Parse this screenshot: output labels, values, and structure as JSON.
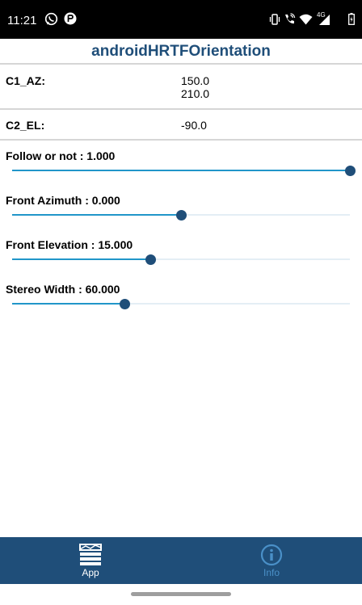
{
  "status_bar": {
    "time": "11:21",
    "network": "4G",
    "icons": [
      "whatsapp-icon",
      "app-notification-icon",
      "vibrate-icon",
      "wifi-calling-icon",
      "wifi-icon",
      "signal-icon",
      "battery-icon"
    ]
  },
  "app": {
    "title": "androidHRTFOrientation"
  },
  "rows": [
    {
      "label": "C1_AZ:",
      "values": [
        "150.0",
        "210.0"
      ]
    },
    {
      "label": "C2_EL:",
      "values": [
        "-90.0"
      ]
    }
  ],
  "sliders": [
    {
      "label": "Follow or not : 1.000",
      "fraction": 1.0
    },
    {
      "label": "Front Azimuth : 0.000",
      "fraction": 0.5
    },
    {
      "label": "Front Elevation : 15.000",
      "fraction": 0.409
    },
    {
      "label": "Stereo Width : 60.000",
      "fraction": 0.333
    }
  ],
  "bottom_nav": {
    "items": [
      {
        "label": "App",
        "icon": "app-icon",
        "active": true,
        "color": "#ffffff"
      },
      {
        "label": "Info",
        "icon": "info-icon",
        "active": false,
        "color": "#4a90c8"
      }
    ]
  },
  "colors": {
    "primary": "#1f4e79",
    "slider_active": "#2196c9",
    "slider_track": "#e4eef5",
    "divider": "#d6d6d6"
  }
}
